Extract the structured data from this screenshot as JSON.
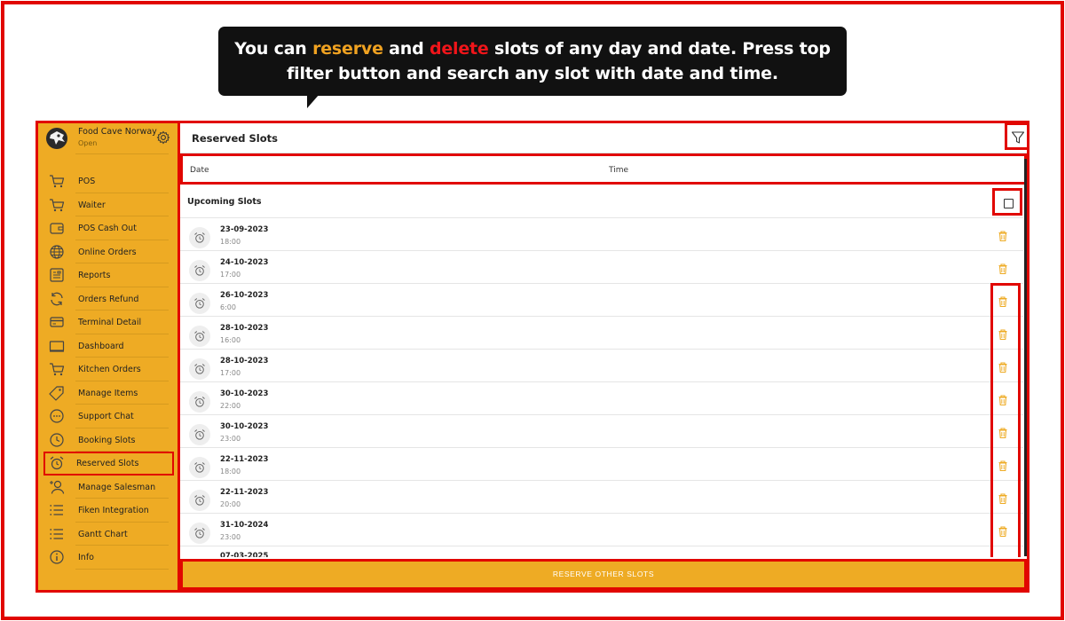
{
  "callout": {
    "prefix": "You can ",
    "word_reserve": "reserve",
    "middle": " and ",
    "word_delete": "delete",
    "suffix": " slots of any day and date.  Press top filter button and search any slot with date and time."
  },
  "brand": {
    "name": "Food Cave Norway",
    "status": "Open"
  },
  "sidebar": {
    "items": [
      {
        "label": "POS",
        "icon": "cart-icon"
      },
      {
        "label": "Waiter",
        "icon": "cart-icon"
      },
      {
        "label": "POS Cash Out",
        "icon": "wallet-icon"
      },
      {
        "label": "Online Orders",
        "icon": "globe-icon"
      },
      {
        "label": "Reports",
        "icon": "report-icon"
      },
      {
        "label": "Orders Refund",
        "icon": "refresh-icon"
      },
      {
        "label": "Terminal Detail",
        "icon": "card-icon"
      },
      {
        "label": "Dashboard",
        "icon": "monitor-icon"
      },
      {
        "label": "Kitchen Orders",
        "icon": "cart-icon"
      },
      {
        "label": "Manage Items",
        "icon": "tag-icon"
      },
      {
        "label": "Support Chat",
        "icon": "chat-icon"
      },
      {
        "label": "Booking Slots",
        "icon": "clock-icon"
      },
      {
        "label": "Reserved Slots",
        "icon": "alarm-icon"
      },
      {
        "label": "Manage Salesman",
        "icon": "add-user-icon"
      },
      {
        "label": "Fiken Integration",
        "icon": "list-icon"
      },
      {
        "label": "Gantt Chart",
        "icon": "list-icon"
      },
      {
        "label": "Info",
        "icon": "info-icon"
      }
    ],
    "active_index": 12
  },
  "header": {
    "title": "Reserved Slots"
  },
  "columns": {
    "date": "Date",
    "time": "Time"
  },
  "section": {
    "upcoming": "Upcoming Slots"
  },
  "slots": [
    {
      "date": "23-09-2023",
      "time": "18:00"
    },
    {
      "date": "24-10-2023",
      "time": "17:00"
    },
    {
      "date": "26-10-2023",
      "time": "6:00"
    },
    {
      "date": "28-10-2023",
      "time": "16:00"
    },
    {
      "date": "28-10-2023",
      "time": "17:00"
    },
    {
      "date": "30-10-2023",
      "time": "22:00"
    },
    {
      "date": "30-10-2023",
      "time": "23:00"
    },
    {
      "date": "22-11-2023",
      "time": "18:00"
    },
    {
      "date": "22-11-2023",
      "time": "20:00"
    },
    {
      "date": "31-10-2024",
      "time": "23:00"
    }
  ],
  "partial_slot": {
    "date": "07-03-2025"
  },
  "footer": {
    "reserve_label": "RESERVE OTHER SLOTS"
  },
  "colors": {
    "accent": "#eeab24",
    "highlight_frame": "#e10600",
    "callout_bg": "#111111",
    "reserve_word": "#f0a221",
    "delete_word": "#f0151a"
  }
}
